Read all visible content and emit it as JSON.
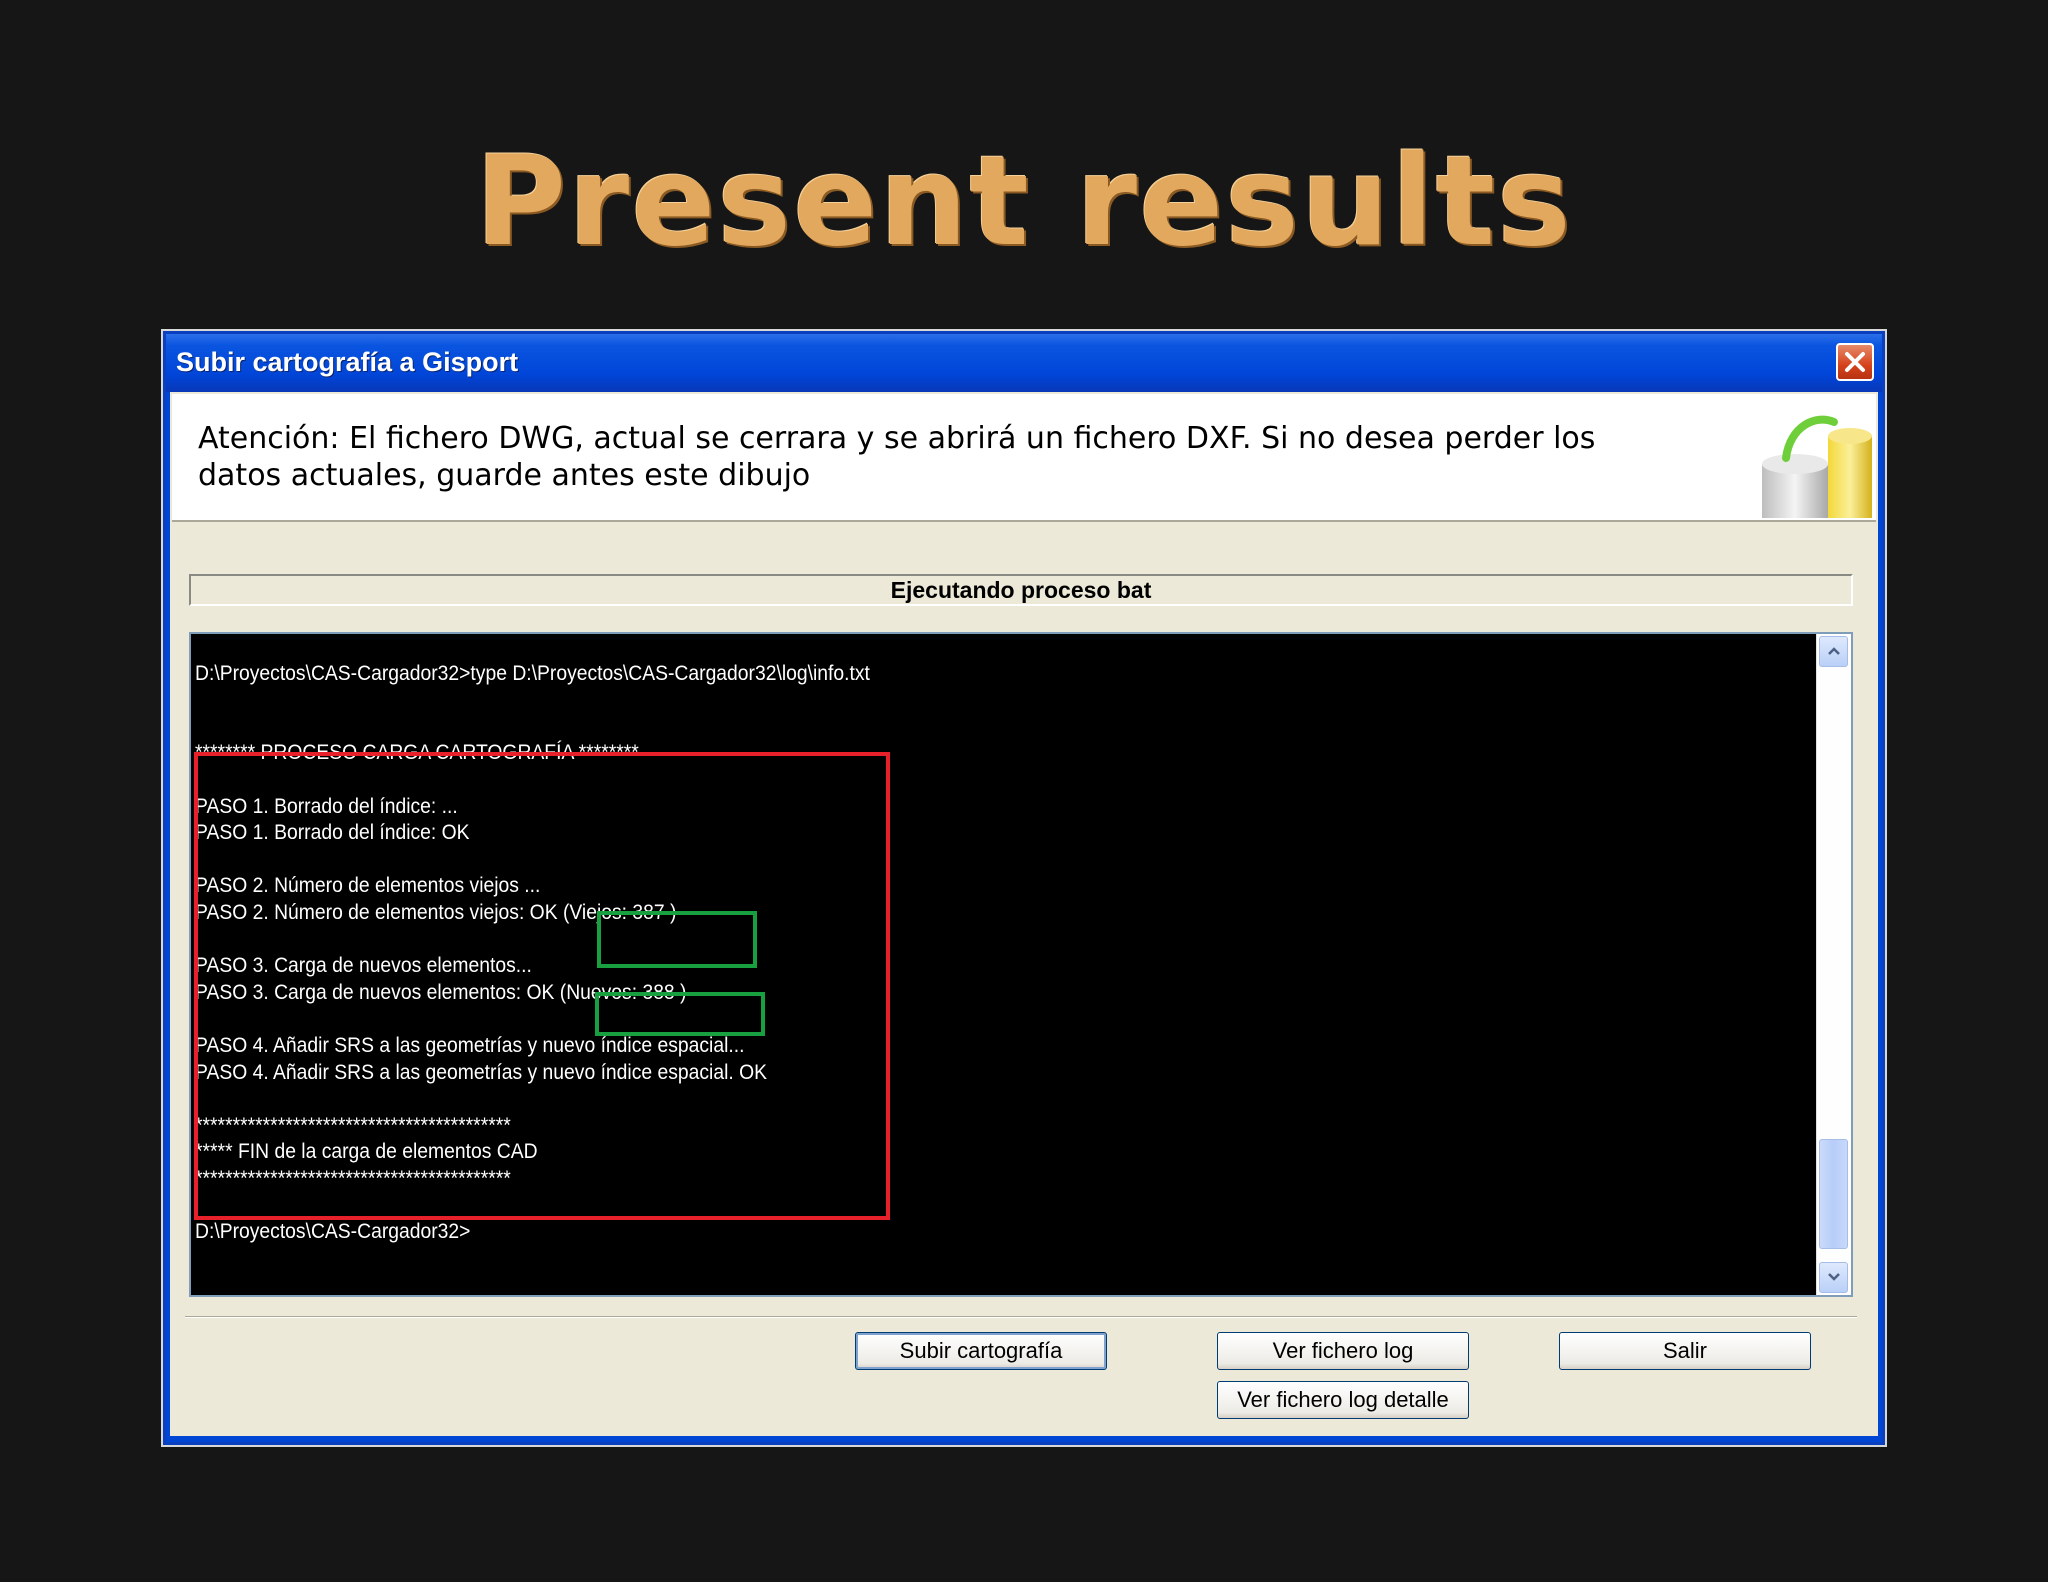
{
  "slide": {
    "title": "Present results"
  },
  "window": {
    "title": "Subir cartografía a Gisport",
    "banner_text": "Atención: El fichero DWG, actual se cerrara y se abrirá un fichero DXF. Si no desea perder los datos actuales, guarde antes este dibujo",
    "status": "Ejecutando proceso bat"
  },
  "console": {
    "lines": [
      "",
      "D:\\Proyectos\\CAS-Cargador32>type D:\\Proyectos\\CAS-Cargador32\\log\\info.txt",
      "",
      "",
      "******** PROCESO CARGA CARTOGRAFÍA ********",
      "",
      "PASO 1. Borrado del índice: ...",
      "PASO 1. Borrado del índice: OK",
      "",
      "PASO 2. Número de elementos viejos ...",
      "PASO 2. Número de elementos viejos: OK (Viejos: 387 )",
      "",
      "PASO 3. Carga de nuevos elementos...",
      "PASO 3. Carga de nuevos elementos: OK (Nuevos: 388 )",
      "",
      "PASO 4. Añadir SRS a las geometrías y nuevo índice espacial...",
      "PASO 4. Añadir SRS a las geometrías y nuevo índice espacial. OK",
      "",
      "******************************************",
      "***** FIN de la carga de elementos CAD",
      "******************************************",
      "",
      "D:\\Proyectos\\CAS-Cargador32>"
    ]
  },
  "buttons": {
    "upload": "Subir cartografía",
    "view_log": "Ver fichero log",
    "exit": "Salir",
    "view_log_detail": "Ver fichero log detalle"
  },
  "icons": {
    "close": "close-icon",
    "banner": "cylinder-arrow-icon",
    "scroll_up": "arrow-up-icon",
    "scroll_down": "arrow-down-icon"
  },
  "colors": {
    "title": "#e2a85e",
    "highlight_red": "#e8202a",
    "highlight_green": "#18a040",
    "titlebar": "#0046d5"
  }
}
